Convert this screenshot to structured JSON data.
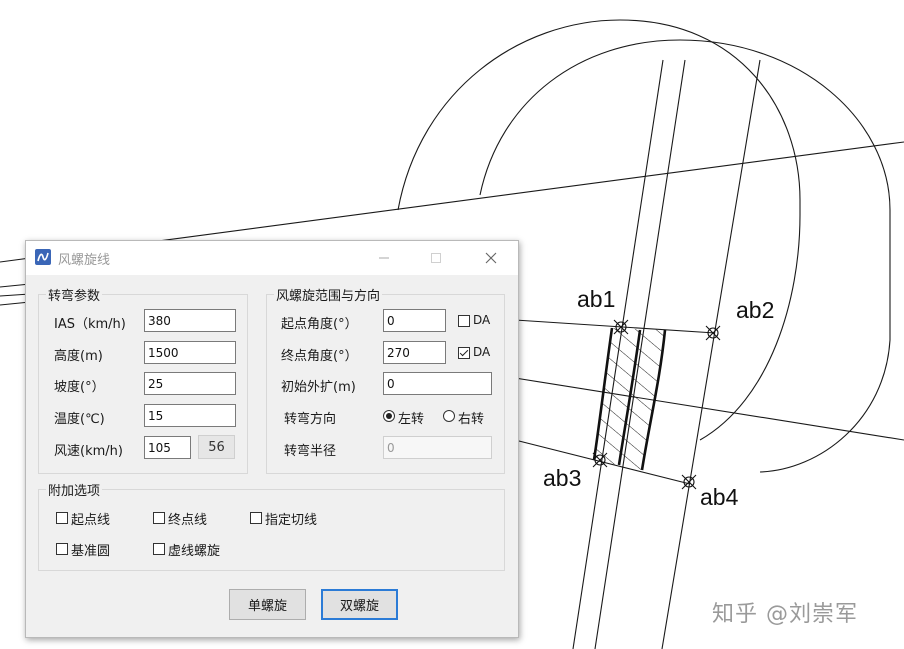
{
  "drawing": {
    "labels": [
      "ab1",
      "ab2",
      "ab3",
      "ab4"
    ],
    "watermark": "知乎 @刘崇军"
  },
  "dialog": {
    "title": "风螺旋线",
    "turn_params": {
      "legend": "转弯参数",
      "ias_label": "IAS（km/h)",
      "ias_value": "380",
      "height_label": "高度(m)",
      "height_value": "1500",
      "slope_label": "坡度(°）",
      "slope_value": "25",
      "temp_label": "温度(℃)",
      "temp_value": "15",
      "wind_label": "风速(km/h)",
      "wind_value": "105",
      "wind_button": "56"
    },
    "range_dir": {
      "legend": "风螺旋范围与方向",
      "start_label": "起点角度(°）",
      "start_value": "0",
      "start_da": "DA",
      "start_da_checked": false,
      "end_label": "终点角度(°）",
      "end_value": "270",
      "end_da": "DA",
      "end_da_checked": true,
      "expand_label": "初始外扩(m)",
      "expand_value": "0",
      "direction_label": "转弯方向",
      "left_label": "左转",
      "right_label": "右转",
      "selected": "left",
      "radius_label": "转弯半径",
      "radius_value": "0"
    },
    "extra": {
      "legend": "附加选项",
      "start_line": "起点线",
      "end_line": "终点线",
      "tangent": "指定切线",
      "base_circle": "基准圆",
      "dashed_spiral": "虚线螺旋"
    },
    "buttons": {
      "single": "单螺旋",
      "double": "双螺旋"
    }
  }
}
